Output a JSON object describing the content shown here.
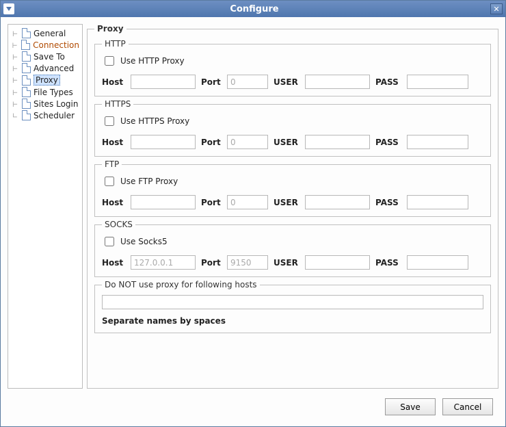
{
  "window": {
    "title": "Configure",
    "close_glyph": "✕"
  },
  "sidebar": {
    "items": [
      {
        "label": "General",
        "selected": false
      },
      {
        "label": "Connection",
        "selected": false,
        "accent": true
      },
      {
        "label": "Save To",
        "selected": false
      },
      {
        "label": "Advanced",
        "selected": false
      },
      {
        "label": "Proxy",
        "selected": true
      },
      {
        "label": "File Types",
        "selected": false
      },
      {
        "label": "Sites Login",
        "selected": false
      },
      {
        "label": "Scheduler",
        "selected": false
      }
    ]
  },
  "main": {
    "title": "Proxy",
    "http": {
      "legend": "HTTP",
      "checkbox_label": "Use HTTP Proxy",
      "checked": false,
      "host_label": "Host",
      "host_value": "",
      "port_label": "Port",
      "port_placeholder": "0",
      "port_value": "",
      "user_label": "USER",
      "user_value": "",
      "pass_label": "PASS",
      "pass_value": ""
    },
    "https": {
      "legend": "HTTPS",
      "checkbox_label": "Use HTTPS Proxy",
      "checked": false,
      "host_label": "Host",
      "host_value": "",
      "port_label": "Port",
      "port_placeholder": "0",
      "port_value": "",
      "user_label": "USER",
      "user_value": "",
      "pass_label": "PASS",
      "pass_value": ""
    },
    "ftp": {
      "legend": "FTP",
      "checkbox_label": "Use FTP Proxy",
      "checked": false,
      "host_label": "Host",
      "host_value": "",
      "port_label": "Port",
      "port_placeholder": "0",
      "port_value": "",
      "user_label": "USER",
      "user_value": "",
      "pass_label": "PASS",
      "pass_value": ""
    },
    "socks": {
      "legend": "SOCKS",
      "checkbox_label": "Use Socks5",
      "checked": false,
      "host_label": "Host",
      "host_placeholder": "127.0.0.1",
      "host_value": "",
      "port_label": "Port",
      "port_placeholder": "9150",
      "port_value": "",
      "user_label": "USER",
      "user_value": "",
      "pass_label": "PASS",
      "pass_value": ""
    },
    "exclude": {
      "legend": "Do NOT use proxy for following hosts",
      "value": "",
      "note": "Separate names by spaces"
    }
  },
  "buttons": {
    "save": "Save",
    "cancel": "Cancel"
  }
}
